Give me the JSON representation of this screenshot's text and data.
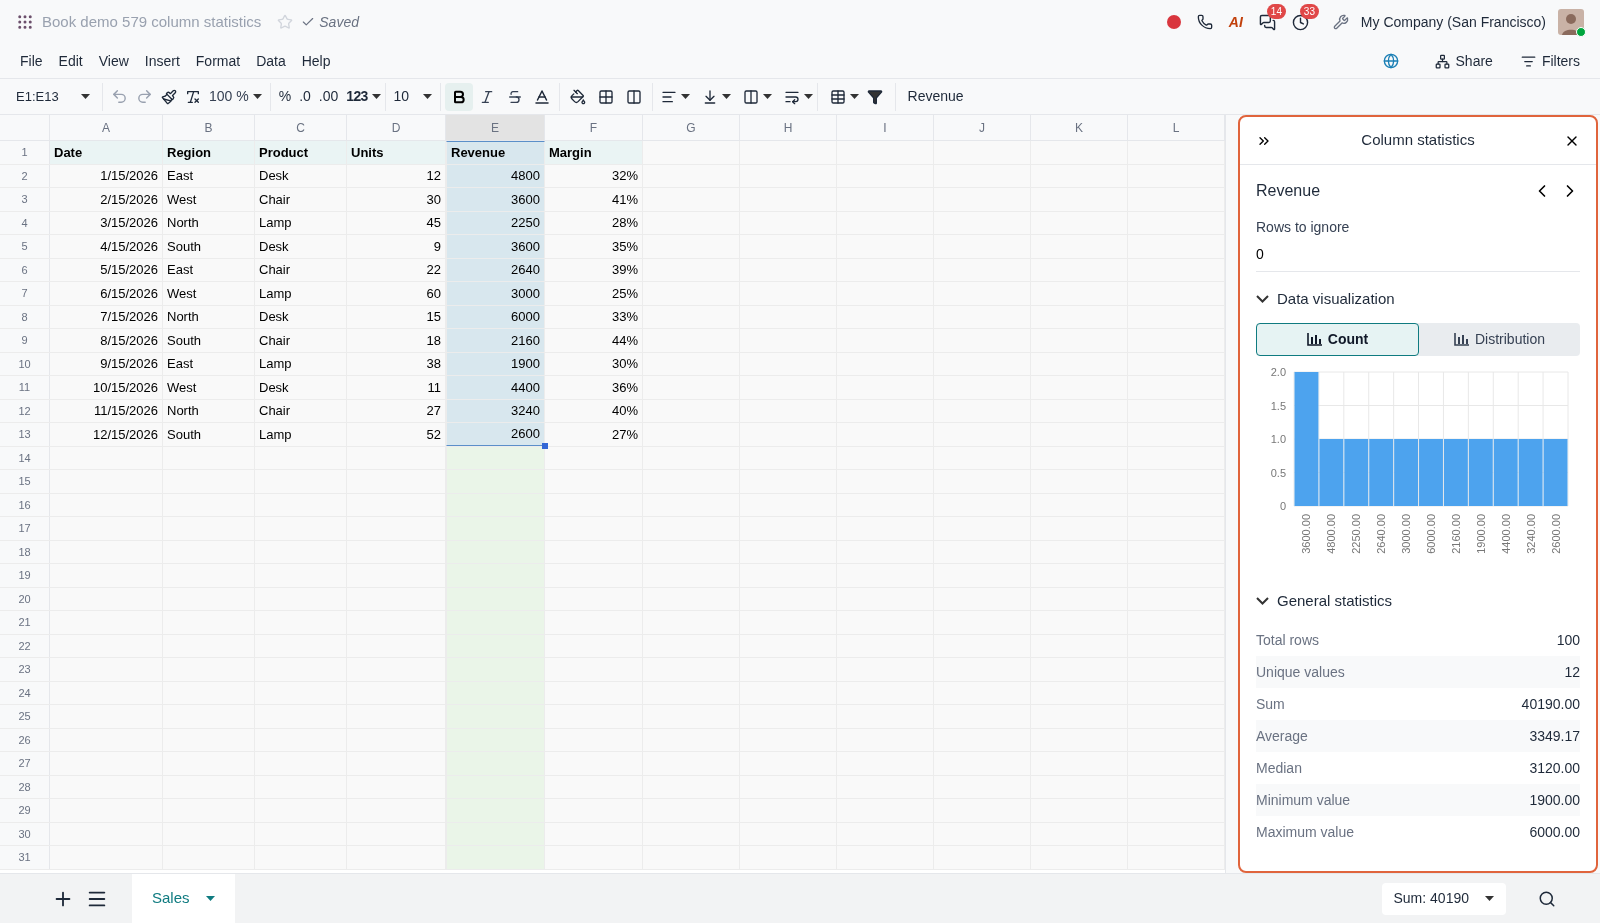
{
  "document": {
    "title": "Book demo 579 column statistics",
    "starred": false,
    "status": "Saved"
  },
  "systray": {
    "ai_label": "AI",
    "badges": [
      "14",
      "33"
    ],
    "company": "My Company (San Francisco)"
  },
  "menu": [
    "File",
    "Edit",
    "View",
    "Insert",
    "Format",
    "Data",
    "Help"
  ],
  "actions": [
    "Share",
    "Filters"
  ],
  "toolbar": {
    "cell_ref": "E1:E13",
    "zoom": "100 %",
    "number_formats": [
      "%",
      ".0",
      ".00",
      "123"
    ],
    "font_size": "10",
    "styles": [
      {
        "kind": "bold",
        "selected": true
      },
      {
        "kind": "italic",
        "selected": false
      },
      {
        "kind": "strike",
        "selected": false
      }
    ],
    "formula": "Revenue"
  },
  "sheet": {
    "columns": [
      {
        "letter": "A",
        "selected": false
      },
      {
        "letter": "B",
        "selected": false
      },
      {
        "letter": "C",
        "selected": false
      },
      {
        "letter": "D",
        "selected": false
      },
      {
        "letter": "E",
        "selected": true
      },
      {
        "letter": "F",
        "selected": false
      },
      {
        "letter": "G",
        "selected": false
      },
      {
        "letter": "H",
        "selected": false
      },
      {
        "letter": "I",
        "selected": false
      },
      {
        "letter": "J",
        "selected": false
      },
      {
        "letter": "K",
        "selected": false
      },
      {
        "letter": "L",
        "selected": false
      }
    ],
    "row_numbers": [
      "1",
      "2",
      "3",
      "4",
      "5",
      "6",
      "7",
      "8",
      "9",
      "10",
      "11",
      "12",
      "13",
      "14",
      "15",
      "16",
      "17",
      "18",
      "19",
      "20",
      "21",
      "22",
      "23",
      "24",
      "25",
      "26",
      "27",
      "28",
      "29",
      "30",
      "31"
    ],
    "rows": [
      [
        "Date",
        "Region",
        "Product",
        "Units",
        "Revenue",
        "Margin"
      ],
      [
        "1/15/2026",
        "East",
        "Desk",
        "12",
        "4800",
        "32%"
      ],
      [
        "2/15/2026",
        "West",
        "Chair",
        "30",
        "3600",
        "41%"
      ],
      [
        "3/15/2026",
        "North",
        "Lamp",
        "45",
        "2250",
        "28%"
      ],
      [
        "4/15/2026",
        "South",
        "Desk",
        "9",
        "3600",
        "35%"
      ],
      [
        "5/15/2026",
        "East",
        "Chair",
        "22",
        "2640",
        "39%"
      ],
      [
        "6/15/2026",
        "West",
        "Lamp",
        "60",
        "3000",
        "25%"
      ],
      [
        "7/15/2026",
        "North",
        "Desk",
        "15",
        "6000",
        "33%"
      ],
      [
        "8/15/2026",
        "South",
        "Chair",
        "18",
        "2160",
        "44%"
      ],
      [
        "9/15/2026",
        "East",
        "Lamp",
        "38",
        "1900",
        "30%"
      ],
      [
        "10/15/2026",
        "West",
        "Desk",
        "11",
        "4400",
        "36%"
      ],
      [
        "11/15/2026",
        "North",
        "Chair",
        "27",
        "3240",
        "40%"
      ],
      [
        "12/15/2026",
        "South",
        "Lamp",
        "52",
        "2600",
        "27%"
      ]
    ]
  },
  "panel": {
    "title": "Column statistics",
    "column_name": "Revenue",
    "rows_to_ignore": {
      "label": "Rows to ignore",
      "value": "0"
    },
    "visualization": {
      "title": "Data visualization",
      "expanded": true,
      "tabs": [
        {
          "label": "Count",
          "selected": true
        },
        {
          "label": "Distribution",
          "selected": false
        }
      ],
      "chart_data": {
        "type": "bar",
        "grid": true,
        "categories": [
          "3600.00",
          "4800.00",
          "2250.00",
          "2640.00",
          "3000.00",
          "6000.00",
          "2160.00",
          "1900.00",
          "4400.00",
          "3240.00",
          "2600.00"
        ],
        "values": [
          2,
          1,
          1,
          1,
          1,
          1,
          1,
          1,
          1,
          1,
          1
        ],
        "ylim": [
          0,
          2
        ],
        "yticks": [
          0,
          {
            "value": 0.5,
            "label": "0.5"
          },
          {
            "value": 1,
            "label": "1.0"
          },
          {
            "value": 1.5,
            "label": "1.5"
          },
          {
            "value": 2,
            "label": "2.0"
          }
        ]
      }
    },
    "statistics": {
      "title": "General statistics",
      "expanded": true,
      "items": [
        {
          "label": "Total rows",
          "value": "100"
        },
        {
          "label": "Unique values",
          "value": "12"
        },
        {
          "label": "Sum",
          "value": "40190.00"
        },
        {
          "label": "Average",
          "value": "3349.17"
        },
        {
          "label": "Median",
          "value": "3120.00"
        },
        {
          "label": "Minimum value",
          "value": "1900.00"
        },
        {
          "label": "Maximum value",
          "value": "6000.00"
        }
      ]
    }
  },
  "footer": {
    "sheets": [
      {
        "label": "Sales",
        "selected": true
      }
    ],
    "aggregate": "Sum: 40190"
  }
}
